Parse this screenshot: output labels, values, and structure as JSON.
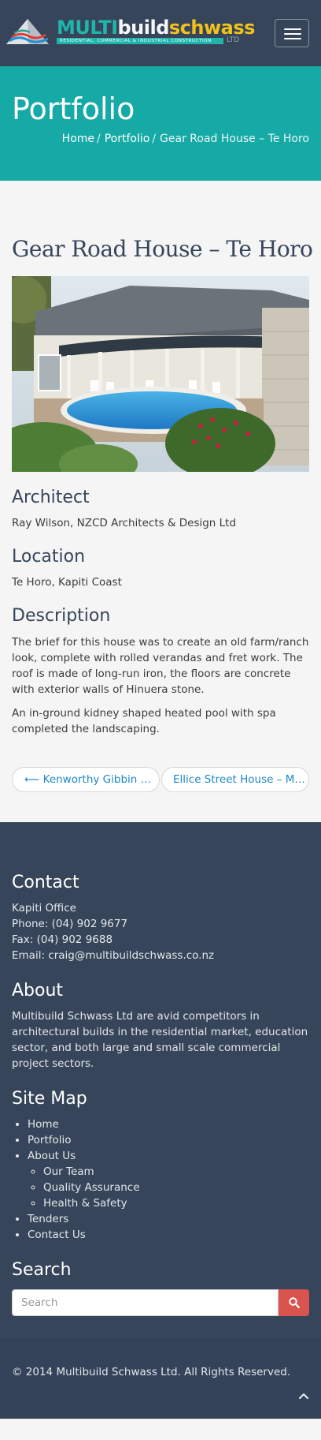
{
  "header": {
    "logo": {
      "word1": "MULTI",
      "word2": "build",
      "word3": "schwass",
      "tagline": "RESIDENTIAL, COMMERCIAL & INDUSTRIAL CONSTRUCTION",
      "suffix": "LTD"
    },
    "menu_icon": "hamburger-icon"
  },
  "banner": {
    "title": "Portfolio",
    "breadcrumb": {
      "home": "Home",
      "sep1": "/",
      "portfolio": "Portfolio",
      "sep2": "/",
      "current": "Gear Road House – Te Horo"
    }
  },
  "project": {
    "title": "Gear Road House – Te Horo",
    "architect_heading": "Architect",
    "architect": "Ray Wilson, NZCD Architects & Design Ltd",
    "location_heading": "Location",
    "location": "Te Horo, Kapiti Coast",
    "description_heading": "Description",
    "description": [
      "The brief for this house was to create an old farm/ranch look, complete with rolled verandas and fret work. The roof is made of long-run iron, the floors are concrete with exterior walls of Hinuera stone.",
      "An in-ground kidney shaped heated pool with spa completed the landscaping."
    ]
  },
  "post_nav": {
    "prev": "⟵ Kenworthy Gibbin H…",
    "next": "Ellice Street House – M…"
  },
  "footer": {
    "contact": {
      "heading": "Contact",
      "lines": [
        "Kapiti Office",
        "Phone: (04) 902 9677",
        "Fax: (04) 902 9688",
        "Email: craig@multibuildschwass.co.nz"
      ]
    },
    "about": {
      "heading": "About",
      "text": "Multibuild Schwass Ltd are avid competitors in architectural builds in the residential market, education sector, and both large and small scale commercial project sectors."
    },
    "sitemap": {
      "heading": "Site Map",
      "home": "Home",
      "portfolio": "Portfolio",
      "about_us": "About Us",
      "our_team": "Our Team",
      "quality": "Quality Assurance",
      "health": "Health & Safety",
      "tenders": "Tenders",
      "contact_us": "Contact Us"
    },
    "search": {
      "heading": "Search",
      "placeholder": "Search",
      "icon": "search-icon"
    },
    "copyright": "© 2014 Multibuild Schwass Ltd. All Rights Reserved.",
    "back_to_top_icon": "chevron-up-icon"
  },
  "colors": {
    "header_bg": "#364559",
    "banner_bg": "#16aaa7",
    "link_blue": "#1e88c7",
    "search_button": "#d9534f",
    "logo_teal": "#1fb5ad",
    "logo_gold": "#f1c21b"
  }
}
